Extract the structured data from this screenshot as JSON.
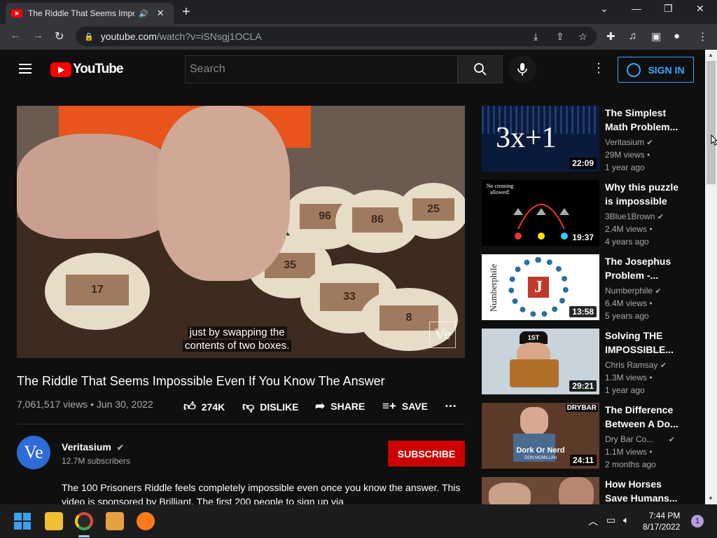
{
  "browser": {
    "tab_title": "The Riddle That Seems Impo",
    "new_tab": "+",
    "url_host": "youtube.com",
    "url_path": "/watch?v=iSNsgj1OCLA"
  },
  "header": {
    "logo_text": "YouTube",
    "search_placeholder": "Search",
    "signin_label": "SIGN IN"
  },
  "player": {
    "caption_line1": "just by swapping the",
    "caption_line2": "contents of two boxes.",
    "watermark": "Ve",
    "disc_numbers": [
      "96",
      "86",
      "25",
      "35",
      "33",
      "17",
      "8"
    ]
  },
  "video": {
    "title": "The Riddle That Seems Impossible Even If You Know The Answer",
    "meta": "7,061,517 views • Jun 30, 2022",
    "likes": "274K",
    "dislike_label": "DISLIKE",
    "share_label": "SHARE",
    "save_label": "SAVE"
  },
  "channel": {
    "avatar_text": "Ve",
    "name": "Veritasium",
    "subscribers": "12.7M subscribers",
    "subscribe_label": "SUBSCRIBE",
    "description": "The 100 Prisoners Riddle feels completely impossible even once you know the answer. This video is sponsored by Brilliant. The first 200 people to sign up via"
  },
  "recommendations": [
    {
      "title": "The Simplest Math Problem...",
      "channel": "Veritasium",
      "views": "29M views •",
      "age": "1 year ago",
      "duration": "22:09",
      "thumb_text": "3x+1"
    },
    {
      "title": "Why this puzzle is impossible",
      "channel": "3Blue1Brown",
      "views": "2.4M views •",
      "age": "4 years ago",
      "duration": "19:37",
      "thumb_text": "No crossing allowed!"
    },
    {
      "title": "The Josephus Problem -...",
      "channel": "Numberphile",
      "views": "6.4M views •",
      "age": "5 years ago",
      "duration": "13:58",
      "thumb_text": "Numberphile",
      "thumb_letter": "J"
    },
    {
      "title": "Solving THE IMPOSSIBLE...",
      "channel": "Chris Ramsay",
      "views": "1.3M views •",
      "age": "1 year ago",
      "duration": "29:21",
      "thumb_text": "1ST"
    },
    {
      "title": "The Difference Between A Do...",
      "channel": "Dry Bar Co...",
      "views": "1.1M views •",
      "age": "2 months ago",
      "duration": "24:11",
      "thumb_text": "Dork Or Nerd",
      "thumb_sub": "DON MCMILLAN",
      "thumb_brand": "DRYBAR"
    },
    {
      "title": "How Horses Save Humans...",
      "channel": "",
      "views": "",
      "age": "",
      "duration": "",
      "thumb_text": ""
    }
  ],
  "taskbar": {
    "time": "7:44 PM",
    "date": "8/17/2022",
    "notification_count": "1"
  },
  "colors": {
    "brand_red": "#ff0000",
    "subscribe_red": "#cc0000",
    "link_blue": "#3ea6ff",
    "background": "#0f0f0f"
  }
}
